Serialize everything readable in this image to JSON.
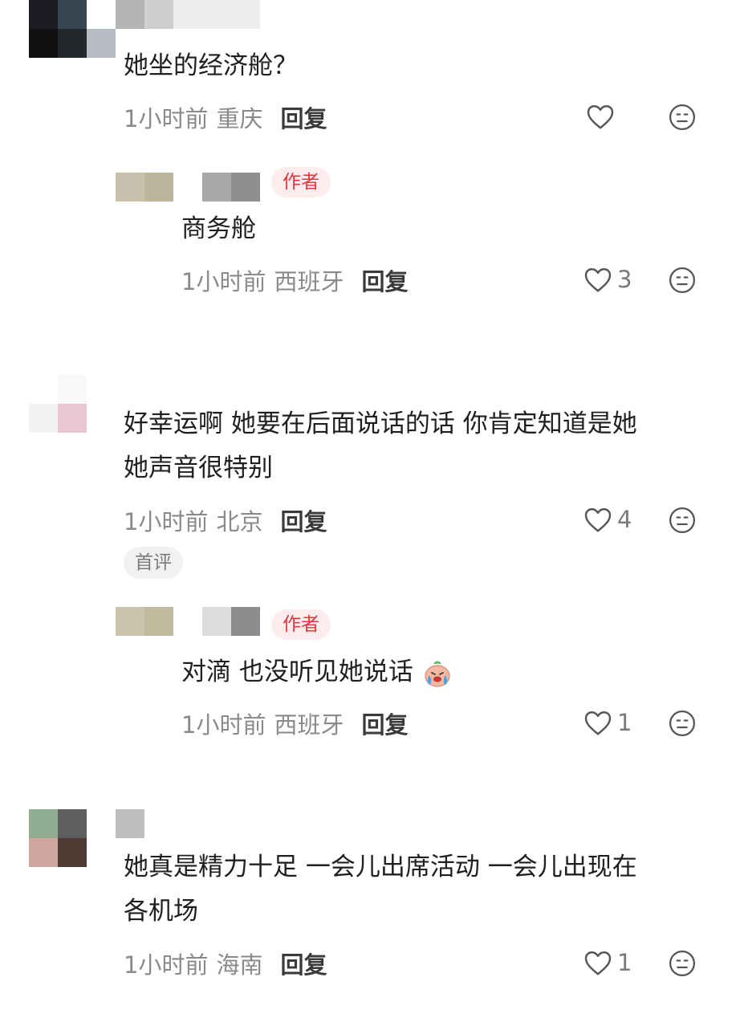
{
  "comments": [
    {
      "text": "她坐的经济舱？",
      "time": "1小时前",
      "location": "重庆",
      "reply_label": "回复",
      "likes": "",
      "replies": [
        {
          "author_badge": "作者",
          "text": "商务舱",
          "time": "1小时前",
          "location": "西班牙",
          "reply_label": "回复",
          "likes": "3"
        }
      ]
    },
    {
      "text_line1": "好幸运啊  她要在后面说话的话 你肯定知道是她",
      "text_line2": "她声音很特别",
      "time": "1小时前",
      "location": "北京",
      "reply_label": "回复",
      "likes": "4",
      "tag": "首评",
      "replies": [
        {
          "author_badge": "作者",
          "text": "对滴 也没听见她说话",
          "emoji": "crying-face-emoji",
          "time": "1小时前",
          "location": "西班牙",
          "reply_label": "回复",
          "likes": "1"
        }
      ]
    },
    {
      "text_line1": "她真是精力十足 一会儿出席活动 一会儿出现在",
      "text_line2": "各机场",
      "time": "1小时前",
      "location": "海南",
      "reply_label": "回复",
      "likes": "1"
    }
  ],
  "icons": {
    "like": "heart-outline-icon",
    "dislike": "meh-face-icon"
  },
  "colors": {
    "author_badge_text": "#e0383e",
    "author_badge_bg": "#fdecee",
    "meta_text": "#8a8a8a"
  }
}
